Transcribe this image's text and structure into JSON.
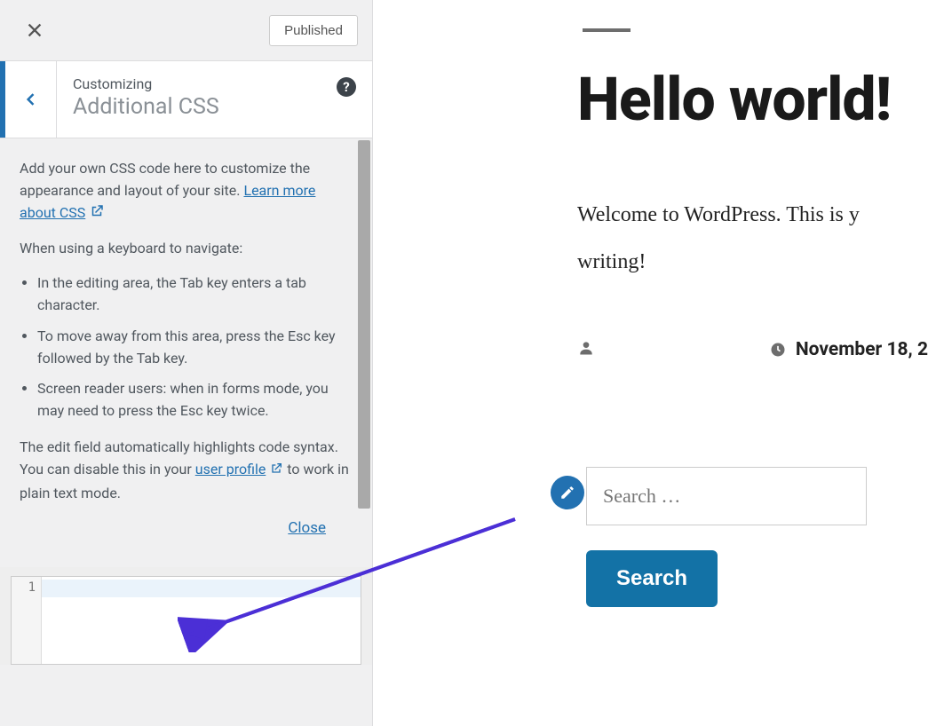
{
  "topbar": {
    "publish_label": "Published"
  },
  "header": {
    "sub": "Customizing",
    "main": "Additional CSS",
    "help": "?"
  },
  "desc": {
    "intro": "Add your own CSS code here to customize the appearance and layout of your site. ",
    "learn_link": "Learn more about CSS",
    "keyboard_intro": "When using a keyboard to navigate:",
    "bullets": [
      "In the editing area, the Tab key enters a tab character.",
      "To move away from this area, press the Esc key followed by the Tab key.",
      "Screen reader users: when in forms mode, you may need to press the Esc key twice."
    ],
    "syntax_1": "The edit field automatically highlights code syntax. You can disable this in your ",
    "user_profile": "user profile",
    "syntax_2": " to work in plain text mode.",
    "close": "Close"
  },
  "editor": {
    "line": "1"
  },
  "preview": {
    "title": "Hello world!",
    "body_1": "Welcome to WordPress. This is y",
    "body_2": "writing!",
    "date": "November 18, 2",
    "search_placeholder": "Search …",
    "search_label": "Search"
  }
}
